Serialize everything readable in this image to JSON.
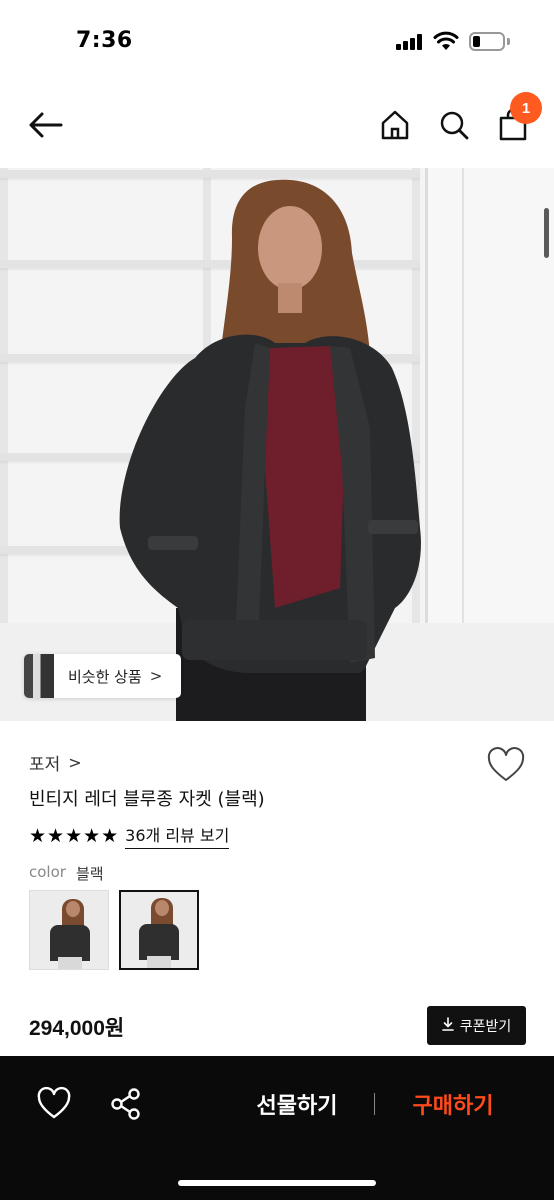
{
  "status_bar": {
    "time": "7:36",
    "battery_level": 0.25
  },
  "nav": {
    "back_icon": "arrow-left-icon",
    "home_icon": "home-icon",
    "search_icon": "search-icon",
    "bag_icon": "shopping-bag-icon",
    "cart_count": "1",
    "badge_color": "#ff5a1f"
  },
  "hero": {
    "similar_products_label": "비슷한 상품",
    "similar_products_arrow": ">"
  },
  "product": {
    "brand": "포저",
    "brand_chevron": ">",
    "title": "빈티지 레더 블루종 자켓 (블랙)",
    "stars": "★★★★★",
    "rating": 5,
    "review_link": "36개 리뷰 보기",
    "color_key": "color",
    "color_value": "블랙",
    "price": "294,000원",
    "coupon_label": "쿠폰받기",
    "coupon_icon": "download-icon"
  },
  "bottom_bar": {
    "like_icon": "heart-outline-icon",
    "share_icon": "share-icon",
    "gift_label": "선물하기",
    "buy_label": "구매하기",
    "buy_color": "#ff4a1a"
  }
}
